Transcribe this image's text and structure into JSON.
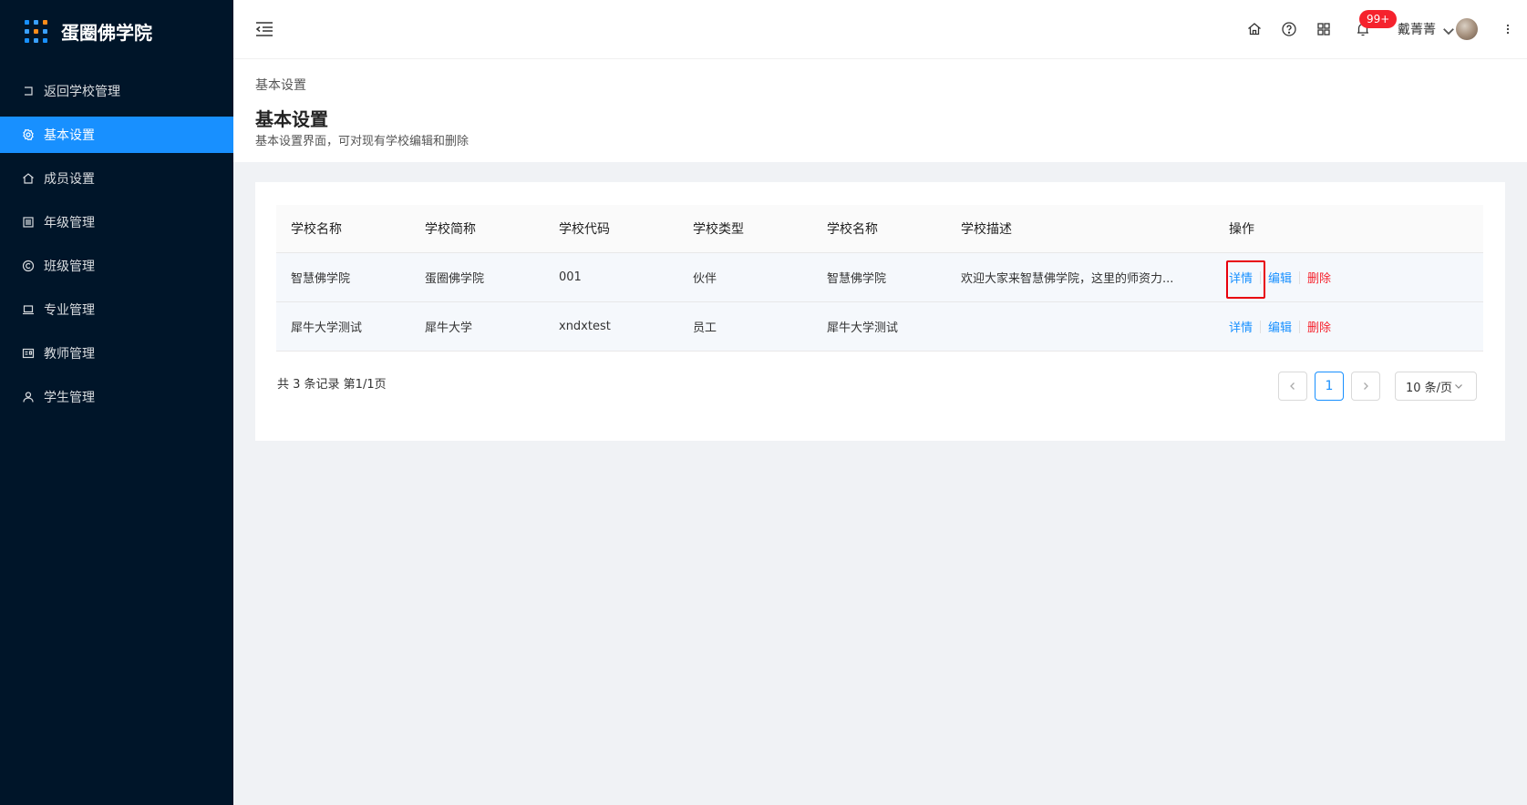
{
  "app": {
    "name": "蛋圈佛学院"
  },
  "colors": {
    "sidebar_bg": "#001529",
    "accent": "#1890ff",
    "danger": "#f5222d",
    "highlight": "#e8000d"
  },
  "sidebar": {
    "items": [
      {
        "label": "返回学校管理",
        "icon": "return-icon"
      },
      {
        "label": "基本设置",
        "icon": "gear-icon",
        "active": true
      },
      {
        "label": "成员设置",
        "icon": "home-icon"
      },
      {
        "label": "年级管理",
        "icon": "document-icon"
      },
      {
        "label": "班级管理",
        "icon": "copyright-icon"
      },
      {
        "label": "专业管理",
        "icon": "laptop-icon"
      },
      {
        "label": "教师管理",
        "icon": "id-card-icon"
      },
      {
        "label": "学生管理",
        "icon": "user-icon"
      }
    ]
  },
  "header": {
    "icons": [
      "home-icon",
      "help-icon",
      "apps-icon",
      "bell-icon"
    ],
    "notification_badge": "99+",
    "username": "戴菁菁"
  },
  "page": {
    "breadcrumb": "基本设置",
    "title": "基本设置",
    "description": "基本设置界面，可对现有学校编辑和删除"
  },
  "table": {
    "columns": [
      "学校名称",
      "学校简称",
      "学校代码",
      "学校类型",
      "学校名称",
      "学校描述",
      "操作"
    ],
    "rows": [
      {
        "name": "智慧佛学院",
        "short": "蛋圈佛学院",
        "code": "001",
        "type": "伙伴",
        "name2": "智慧佛学院",
        "desc": "欢迎大家来智慧佛学院，这里的师资力..."
      },
      {
        "name": "犀牛大学测试",
        "short": "犀牛大学",
        "code": "xndxtest",
        "type": "员工",
        "name2": "犀牛大学测试",
        "desc": ""
      }
    ],
    "actions": {
      "detail": "详情",
      "edit": "编辑",
      "delete": "删除"
    }
  },
  "pagination": {
    "summary": "共 3 条记录 第1/1页",
    "current_page": "1",
    "prev": "<",
    "next": ">",
    "page_size": "10 条/页"
  }
}
